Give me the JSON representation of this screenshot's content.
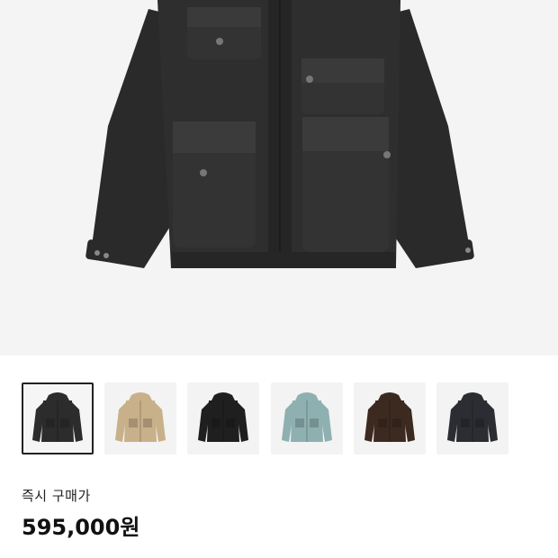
{
  "product": {
    "image_icon": "jacket-image",
    "thumbnails": [
      {
        "icon": "jacket-black-thumbnail",
        "color": "#2c2c2c",
        "selected": true
      },
      {
        "icon": "jacket-beige-thumbnail",
        "color": "#c8b08a",
        "selected": false
      },
      {
        "icon": "jacket-black-hooded-thumbnail",
        "color": "#1f1f1f",
        "selected": false
      },
      {
        "icon": "jacket-sage-thumbnail",
        "color": "#8fb0b1",
        "selected": false
      },
      {
        "icon": "jacket-brown-thumbnail",
        "color": "#3c2a20",
        "selected": false
      },
      {
        "icon": "jacket-navy-thumbnail",
        "color": "#2b2d33",
        "selected": false
      }
    ]
  },
  "pricing": {
    "label": "즉시 구매가",
    "price": "595,000원"
  }
}
